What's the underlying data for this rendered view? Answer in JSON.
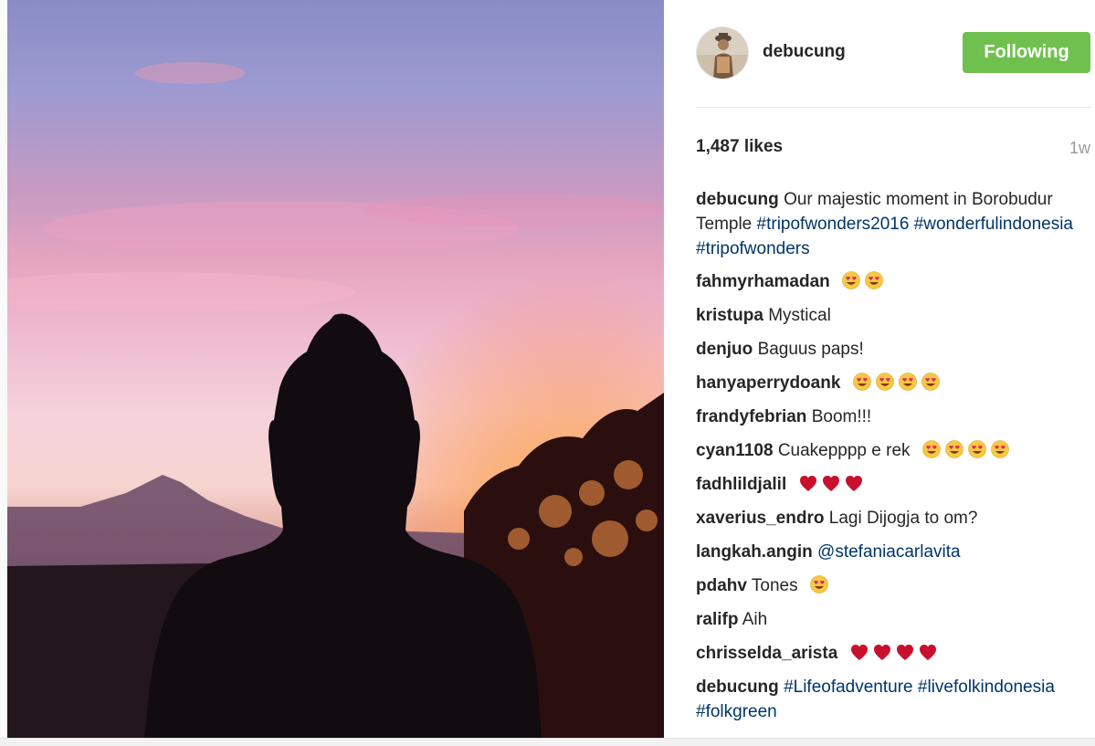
{
  "post": {
    "likes": "1,487 likes",
    "time_ago": "1w"
  },
  "author": {
    "username": "debucung",
    "follow_label": "Following"
  },
  "colors": {
    "follow_button": "#70c050",
    "hashtag": "#003569",
    "text": "#262626",
    "muted": "#9a9a9a"
  },
  "caption": {
    "user": "debucung",
    "text": "Our majestic moment in Borobudur Temple",
    "tags": [
      "#tripofwonders2016",
      "#wonderfulindonesia",
      "#tripofwonders"
    ]
  },
  "comments": [
    {
      "user": "fahmyrhamadan",
      "text": "",
      "emojis": [
        "heart-eyes",
        "heart-eyes"
      ]
    },
    {
      "user": "kristupa",
      "text": "Mystical",
      "emojis": []
    },
    {
      "user": "denjuo",
      "text": "Baguus paps!",
      "emojis": []
    },
    {
      "user": "hanyaperrydoank",
      "text": "",
      "emojis": [
        "heart-eyes",
        "heart-eyes",
        "heart-eyes",
        "heart-eyes"
      ]
    },
    {
      "user": "frandyfebrian",
      "text": "Boom!!!",
      "emojis": []
    },
    {
      "user": "cyan1108",
      "text": "Cuakepppp e rek",
      "emojis": [
        "heart-eyes",
        "heart-eyes",
        "heart-eyes",
        "heart-eyes"
      ]
    },
    {
      "user": "fadhlildjalil",
      "text": "",
      "emojis": [
        "red-heart",
        "red-heart",
        "red-heart"
      ]
    },
    {
      "user": "xaverius_endro",
      "text": "Lagi Dijogja to om?",
      "emojis": []
    },
    {
      "user": "langkah.angin",
      "text": "",
      "mention": "@stefaniacarlavita",
      "emojis": []
    },
    {
      "user": "pdahv",
      "text": "Tones",
      "emojis": [
        "heart-eyes"
      ]
    },
    {
      "user": "ralifp",
      "text": "Aih",
      "emojis": []
    },
    {
      "user": "chrisselda_arista",
      "text": "",
      "emojis": [
        "red-heart",
        "red-heart",
        "red-heart",
        "red-heart"
      ]
    },
    {
      "user": "debucung",
      "text": "",
      "tags": [
        "#Lifeofadventure",
        "#livefolkindonesia",
        "#folkgreen"
      ],
      "emojis": []
    }
  ],
  "icons": {
    "heart_eyes": "heart-eyes-emoji-icon",
    "red_heart": "red-heart-emoji-icon"
  }
}
